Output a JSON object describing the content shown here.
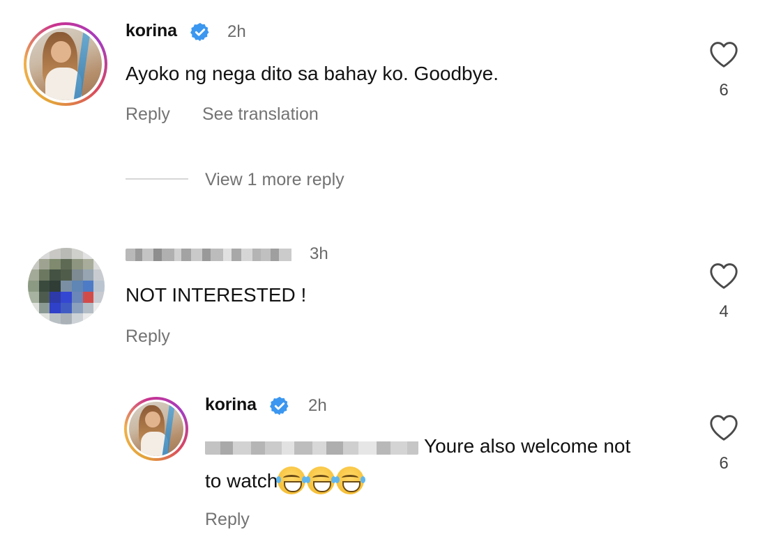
{
  "comments": [
    {
      "username": "korina",
      "time": "2h",
      "text": "Ayoko ng nega dito sa bahay ko. Goodbye.",
      "reply_label": "Reply",
      "translate_label": "See translation",
      "likes": "6"
    },
    {
      "username": "",
      "time": "3h",
      "text": "NOT INTERESTED !",
      "reply_label": "Reply",
      "likes": "4"
    },
    {
      "username": "korina",
      "time": "2h",
      "text_line1": "Youre also welcome not",
      "text_line2": "to watch",
      "emojis": [
        "face-with-tears-of-joy",
        "face-with-tears-of-joy",
        "face-with-tears-of-joy"
      ],
      "reply_label": "Reply",
      "likes": "6"
    }
  ],
  "view_more_replies": "View 1 more reply",
  "colors": {
    "verified_badge": "#3b97f0",
    "secondary_text": "#737373",
    "divider": "#d6d6d6"
  },
  "icons": {
    "like": "heart-outline-icon",
    "verified": "verified-badge-icon"
  }
}
